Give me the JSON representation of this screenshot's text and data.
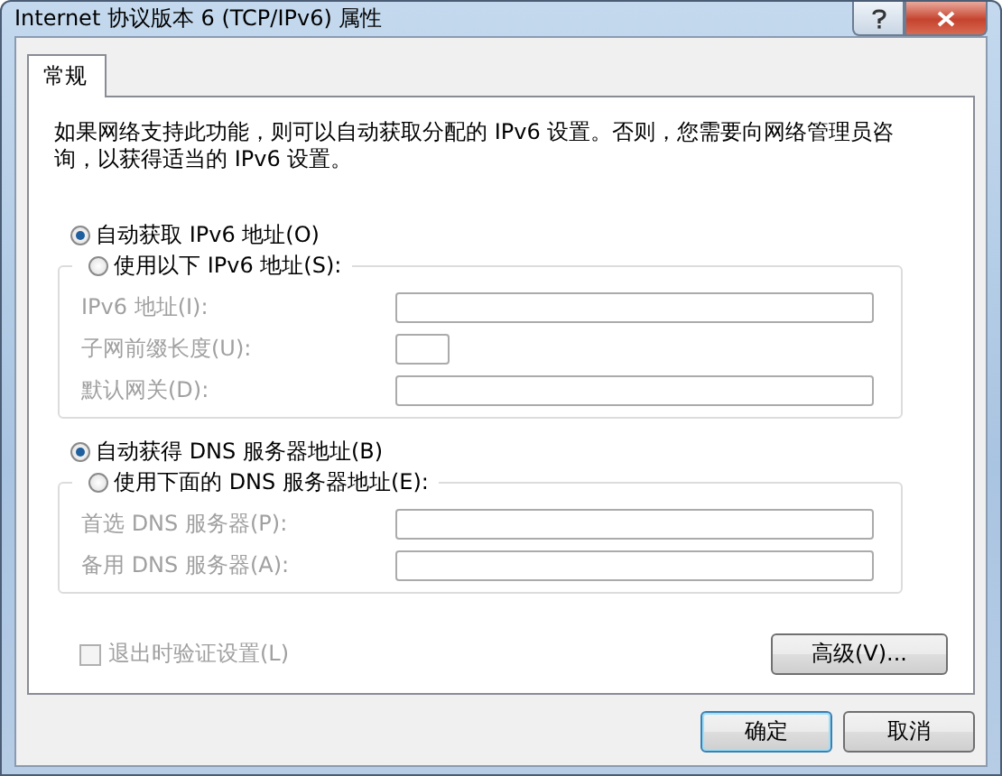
{
  "window": {
    "title": "Internet 协议版本 6 (TCP/IPv6) 属性"
  },
  "tabs": [
    {
      "label": "常规",
      "selected": true
    }
  ],
  "description": "如果网络支持此功能，则可以自动获取分配的 IPv6 设置。否则，您需要向网络管理员咨询，以获得适当的 IPv6 设置。",
  "groups": [
    {
      "radios": [
        {
          "label": "自动获取 IPv6 地址(O)",
          "selected": true
        },
        {
          "label": "使用以下 IPv6 地址(S):",
          "selected": false
        }
      ],
      "fields": [
        {
          "label": "IPv6 地址(I):",
          "kind": "wide",
          "disabled": true
        },
        {
          "label": "子网前缀长度(U):",
          "kind": "narrow",
          "disabled": true
        },
        {
          "label": "默认网关(D):",
          "kind": "wide",
          "disabled": true
        }
      ]
    },
    {
      "radios": [
        {
          "label": "自动获得 DNS 服务器地址(B)",
          "selected": true
        },
        {
          "label": "使用下面的 DNS 服务器地址(E):",
          "selected": false
        }
      ],
      "fields": [
        {
          "label": "首选 DNS 服务器(P):",
          "kind": "wide",
          "disabled": true
        },
        {
          "label": "备用 DNS 服务器(A):",
          "kind": "wide",
          "disabled": true
        }
      ]
    }
  ],
  "validate_checkbox": {
    "label": "退出时验证设置(L)",
    "checked": false,
    "disabled": true
  },
  "advanced_button": "高级(V)...",
  "buttons": [
    {
      "label": "确定",
      "kind": "default"
    },
    {
      "label": "取消",
      "kind": "normal"
    }
  ]
}
